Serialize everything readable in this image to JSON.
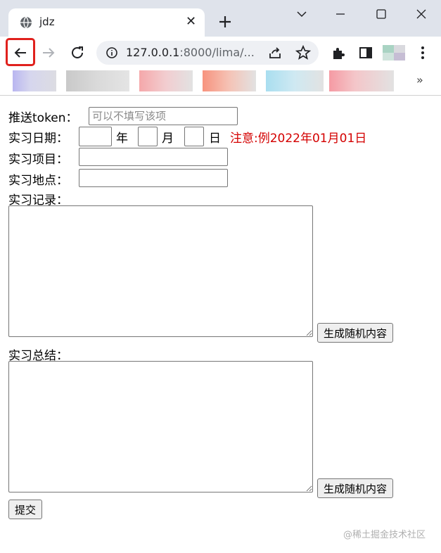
{
  "browser": {
    "tab": {
      "title": "jdz",
      "close": "✕"
    },
    "new_tab": "+",
    "address": {
      "host": "127.0.0.1",
      "rest": ":8000/lima/..."
    },
    "bookmarks_more": "»",
    "bookmark_colors": [
      "#b9b6f0",
      "#c9c9c9",
      "#f5a8aa",
      "#f7937e",
      "#a9def0",
      "#f59aa3"
    ]
  },
  "form": {
    "token_label": "推送token：",
    "token_placeholder": "可以不填写该项",
    "date_label": "实习日期：",
    "year_unit": "年",
    "month_unit": "月",
    "day_unit": "日",
    "date_note": "注意:例2022年01月01日",
    "project_label": "实习项目：",
    "location_label": "实习地点：",
    "record_label": "实习记录：",
    "record_generate": "生成随机内容",
    "summary_label": "实习总结：",
    "summary_generate": "生成随机内容",
    "submit": "提交"
  },
  "watermark": "@稀土掘金技术社区",
  "colors": {
    "note": "#d40000",
    "highlight": "#e0211d",
    "titlebar": "#dfe3eb"
  }
}
